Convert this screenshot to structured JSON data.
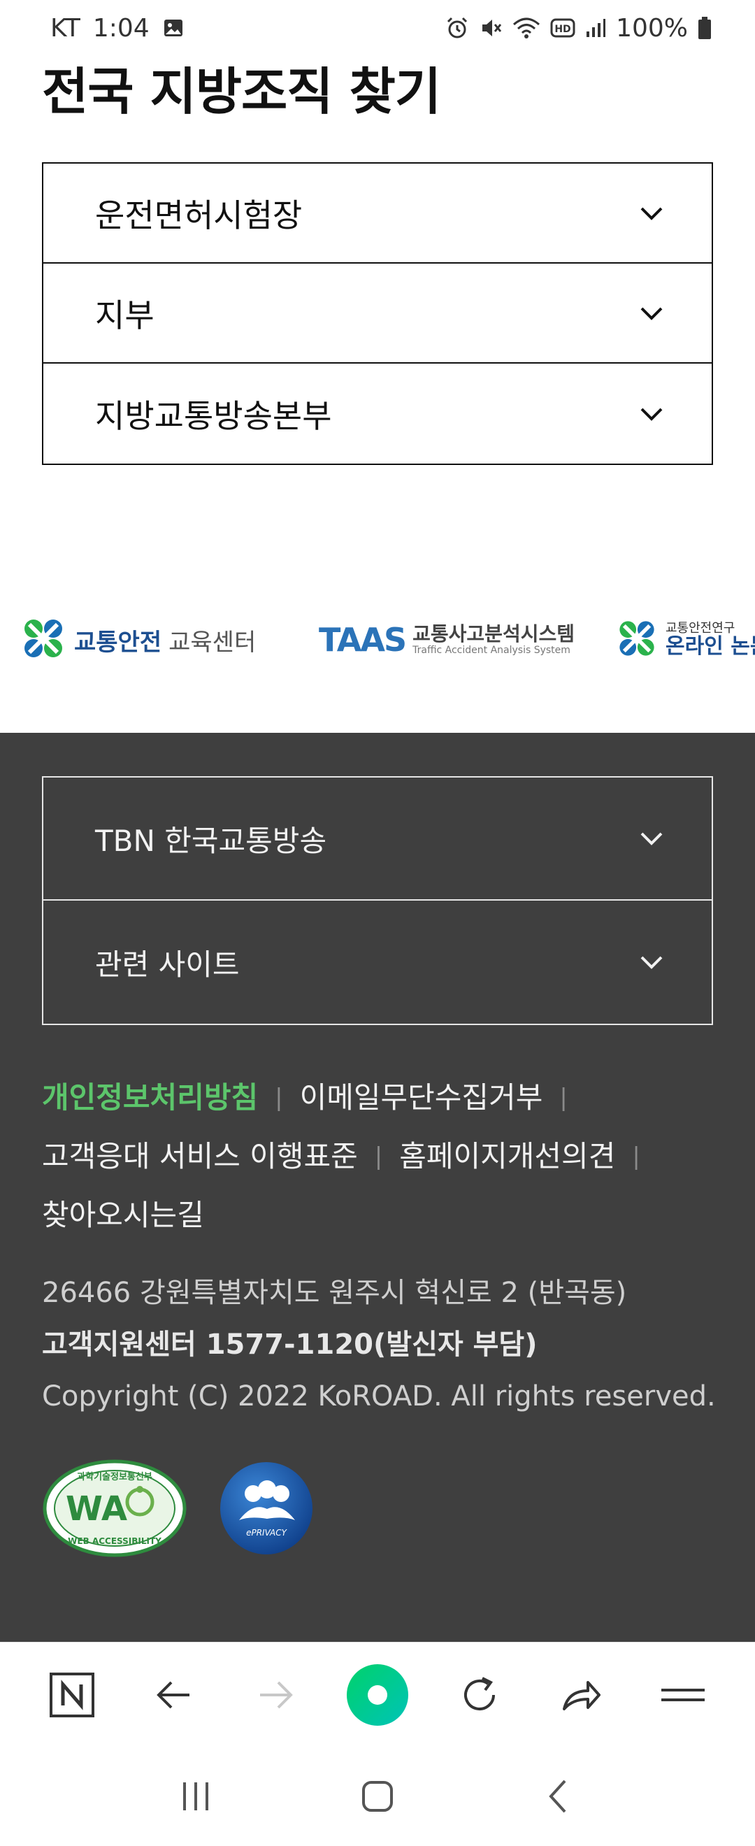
{
  "status_bar": {
    "carrier": "KT",
    "time": "1:04",
    "battery": "100%",
    "icons": [
      "image-icon",
      "alarm-icon",
      "mute-icon",
      "wifi-icon",
      "hd-icon",
      "signal-icon",
      "battery-icon"
    ]
  },
  "page": {
    "title": "전국 지방조직 찾기"
  },
  "accordion": {
    "items": [
      {
        "label": "운전면허시험장"
      },
      {
        "label": "지부"
      },
      {
        "label": "지방교통방송본부"
      }
    ]
  },
  "partners": {
    "logo1": {
      "title": "교통안전",
      "sub": "교육센터"
    },
    "logo2": {
      "mark": "TAAS",
      "korean": "교통사고분석시스템",
      "english": "Traffic Accident Analysis System"
    },
    "logo3": {
      "small": "교통안전연구",
      "big": "온라인 논문투"
    }
  },
  "footer": {
    "accordion": [
      {
        "label": "TBN 한국교통방송"
      },
      {
        "label": "관련 사이트"
      }
    ],
    "links": {
      "privacy": "개인정보처리방침",
      "email": "이메일무단수집거부",
      "service": "고객응대 서비스 이행표준",
      "improve": "홈페이지개선의견",
      "directions": "찾아오시는길"
    },
    "address": "26466 강원특별자치도 원주시 혁신로 2 (반곡동)",
    "call_center": "고객지원센터 1577-1120(발신자 부담)",
    "copyright": "Copyright (C) 2022 KoROAD. All rights reserved.",
    "badges": {
      "wa_top": "과학기술정보통신부",
      "wa_mark": "WA",
      "wa_bottom": "WEB ACCESSIBILITY",
      "eprivacy": "ePRIVACY"
    }
  },
  "browser_toolbar": {
    "buttons": [
      "naver-home-icon",
      "back-icon",
      "forward-icon",
      "green-dot-icon",
      "refresh-icon",
      "share-icon",
      "menu-icon"
    ]
  },
  "colors": {
    "footer_bg": "#3f3f3f",
    "accent_green": "#5cc56b",
    "naver_green": "#03c75a"
  }
}
